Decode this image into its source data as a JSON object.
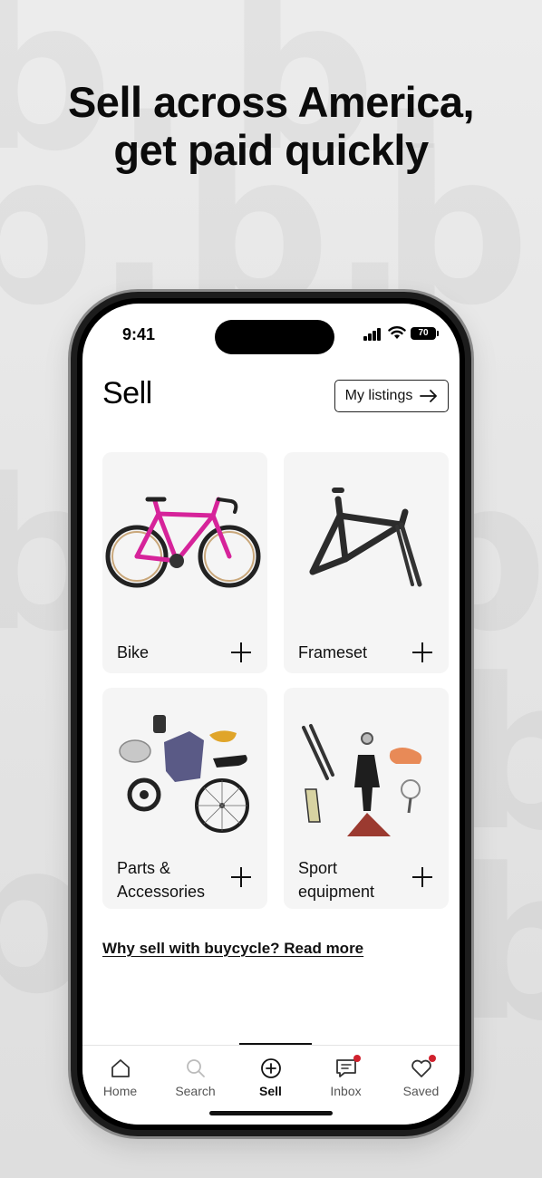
{
  "headline": {
    "line1": "Sell across America,",
    "line2": "get paid quickly"
  },
  "status_bar": {
    "time": "9:41",
    "battery": "70"
  },
  "header": {
    "title": "Sell",
    "my_listings_label": "My listings"
  },
  "categories": [
    {
      "label": "Bike"
    },
    {
      "label": "Frameset"
    },
    {
      "label_line1": "Parts &",
      "label_line2": "Accessories"
    },
    {
      "label_line1": "Sport",
      "label_line2": "equipment"
    }
  ],
  "read_more_link": "Why sell with buycycle? Read more",
  "tabbar": {
    "items": [
      {
        "label": "Home",
        "icon": "home-icon"
      },
      {
        "label": "Search",
        "icon": "search-icon"
      },
      {
        "label": "Sell",
        "icon": "plus-circle-icon",
        "active": true
      },
      {
        "label": "Inbox",
        "icon": "chat-icon",
        "badge": true
      },
      {
        "label": "Saved",
        "icon": "heart-icon",
        "badge": true
      }
    ]
  },
  "colors": {
    "badge": "#d0212d",
    "bike_frame": "#d6239a"
  }
}
